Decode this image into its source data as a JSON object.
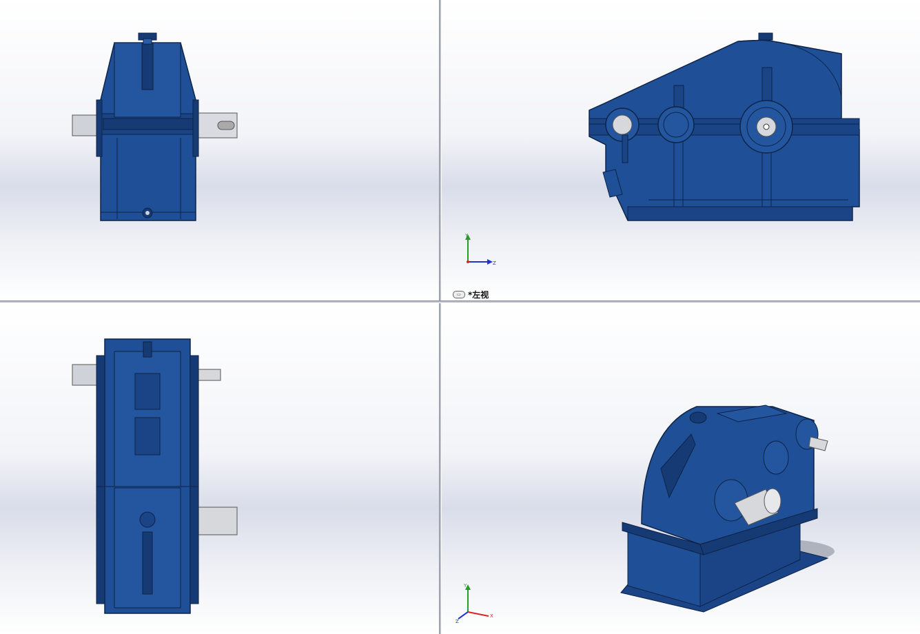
{
  "viewports": {
    "top_right": {
      "view_label": "*左视",
      "view_icon": "view-orientation-icon"
    },
    "triad_axes": {
      "x": "X",
      "y": "Y",
      "z": "Z"
    }
  },
  "colors": {
    "body_blue": "#1f4f96",
    "dark_blue": "#163a73",
    "shaft_gray": "#d6d8dc",
    "axis_red": "#d22",
    "axis_green": "#2a9a2a",
    "axis_blue": "#2233cc"
  }
}
